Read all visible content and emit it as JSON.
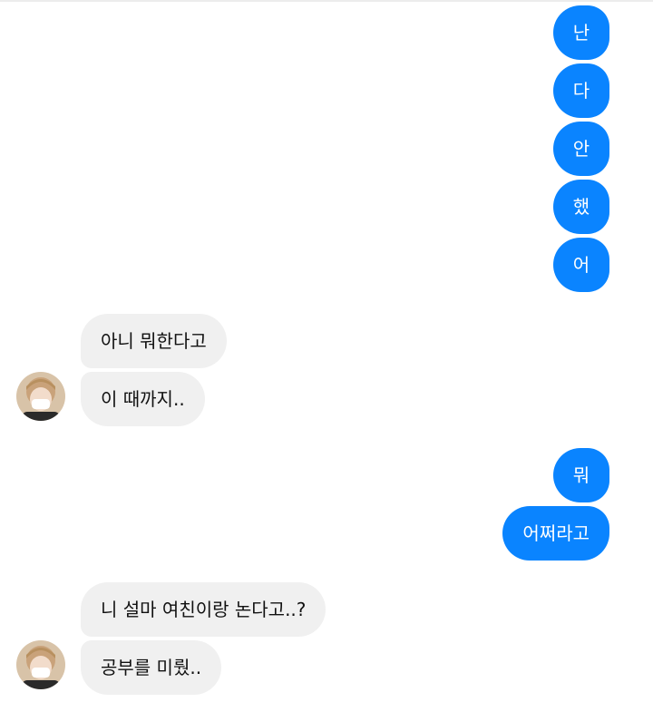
{
  "conversation": {
    "messages": [
      {
        "sender": "me",
        "text": "난"
      },
      {
        "sender": "me",
        "text": "다"
      },
      {
        "sender": "me",
        "text": "안"
      },
      {
        "sender": "me",
        "text": "했"
      },
      {
        "sender": "me",
        "text": "어"
      },
      {
        "sender": "other",
        "text": "아니 뭐한다고"
      },
      {
        "sender": "other",
        "text": "이 때까지.."
      },
      {
        "sender": "me",
        "text": "뭐"
      },
      {
        "sender": "me",
        "text": "어쩌라고"
      },
      {
        "sender": "other",
        "text": "니 설마 여친이랑 논다고..?"
      },
      {
        "sender": "other",
        "text": "공부를 미뤘.."
      }
    ]
  },
  "colors": {
    "outgoing_bubble": "#0a84ff",
    "incoming_bubble": "#f0f0f0"
  },
  "icons": {
    "contact_avatar": "avatar-photo-icon"
  }
}
